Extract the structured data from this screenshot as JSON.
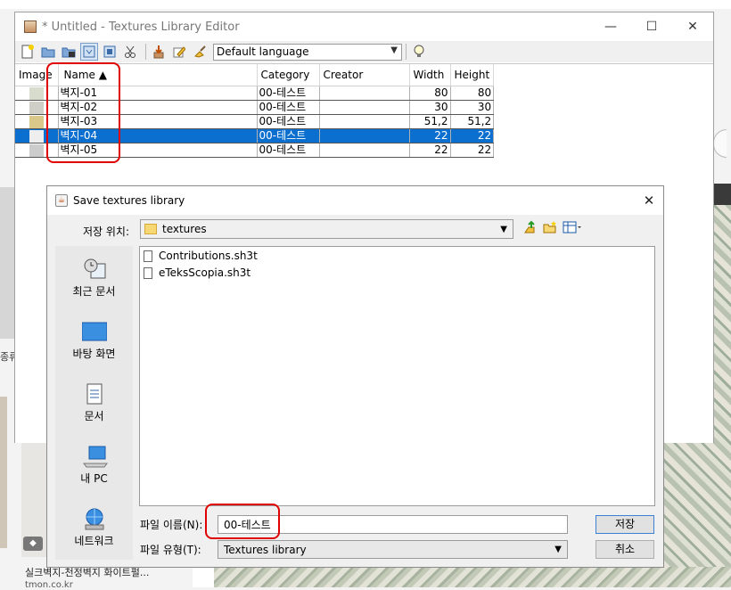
{
  "background": {
    "left_text": "종류",
    "badge": "◆",
    "bottom_title": "실크벽지-천정벽지 화이트펄...",
    "bottom_source": "tmon.co.kr"
  },
  "main_window": {
    "title": "* Untitled - Textures Library Editor",
    "controls": {
      "minimize": "—",
      "maximize": "☐",
      "close": "✕"
    },
    "toolbar": {
      "language": "Default language"
    },
    "table": {
      "columns": [
        "Image",
        "Name ▲",
        "Category",
        "Creator",
        "Width",
        "Height"
      ],
      "rows": [
        {
          "name": "벽지-01",
          "category": "00-테스트",
          "creator": "",
          "width": "80",
          "height": "80",
          "thumb": "#d8dccc"
        },
        {
          "name": "벽지-02",
          "category": "00-테스트",
          "creator": "",
          "width": "30",
          "height": "30",
          "thumb": "#cfcfc8"
        },
        {
          "name": "벽지-03",
          "category": "00-테스트",
          "creator": "",
          "width": "51,2",
          "height": "51,2",
          "thumb": "#d9c88a"
        },
        {
          "name": "벽지-04",
          "category": "00-테스트",
          "creator": "",
          "width": "22",
          "height": "22",
          "thumb": "#eeeeee"
        },
        {
          "name": "벽지-05",
          "category": "00-테스트",
          "creator": "",
          "width": "22",
          "height": "22",
          "thumb": "#cccccc"
        }
      ],
      "selected_index": 3
    }
  },
  "save_dialog": {
    "title": "Save textures library",
    "java_icon": "☕",
    "close": "✕",
    "save_in_label": "저장 위치:",
    "save_in_value": "textures",
    "places": [
      {
        "label": "최근 문서",
        "icon": "recent-documents-icon"
      },
      {
        "label": "바탕 화면",
        "icon": "desktop-icon"
      },
      {
        "label": "문서",
        "icon": "documents-icon"
      },
      {
        "label": "내 PC",
        "icon": "computer-icon"
      },
      {
        "label": "네트워크",
        "icon": "network-icon"
      }
    ],
    "files": [
      "Contributions.sh3t",
      "eTeksScopia.sh3t"
    ],
    "file_name_label": "파일 이름(N):",
    "file_name_value": "00-테스트",
    "file_type_label": "파일 유형(T):",
    "file_type_value": "Textures library",
    "save_button": "저장",
    "cancel_button": "취소"
  },
  "colors": {
    "selection": "#0a6fcf",
    "annotation_red": "#e00000"
  }
}
